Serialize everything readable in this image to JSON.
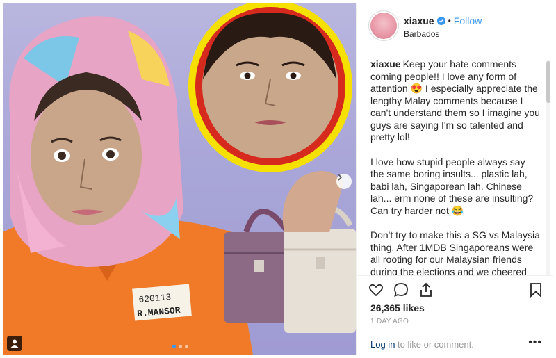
{
  "post": {
    "username": "xiaxue",
    "separator": "•",
    "follow_label": "Follow",
    "location": "Barbados",
    "caption_paragraphs": [
      "Keep your hate comments coming people!! I love any form of attention 😍 I especially appreciate the lengthy Malay comments because I can't understand them so I imagine you guys are saying I'm so talented and pretty lol!",
      "I love how stupid people always say the same boring insults... plastic lah, babi lah, Singaporean lah, Chinese lah... erm none of these are insulting? Can try harder not 😂",
      "Don't try to make this a SG vs Malaysia thing. After 1MDB Singaporeans were all rooting for our Malaysian friends during the elections and we cheered together with them when the results came out. Their high spirits of hope and renewed faith was infectious and Singapore felt it too. Disliking the Razaks isn't equal to disliking Malaysia at all 😊"
    ],
    "likes": "26,365 likes",
    "time_ago": "1 DAY AGO",
    "login_link": "Log in",
    "login_rest": " to like or comment.",
    "more_label": "•••"
  },
  "media": {
    "name_tag_number": "620113",
    "name_tag_name": "R.MANSOR",
    "carousel_count": 3,
    "carousel_active": 0
  },
  "colors": {
    "link_blue": "#3897f0",
    "dark_text": "#262626",
    "muted_text": "#999999"
  },
  "icons": [
    "heart-icon",
    "comment-icon",
    "share-icon",
    "bookmark-icon",
    "user-tag-icon",
    "chevron-right-icon",
    "verified-icon"
  ]
}
